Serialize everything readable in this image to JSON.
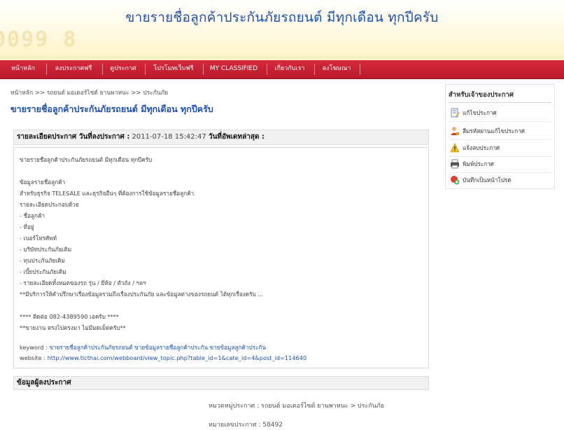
{
  "header": {
    "site_title": "ขายรายชื่อลูกค้าประกันภัยรถยนต์ มีทุกเดือน ทุกปีครับ",
    "deco_text": "0099 8"
  },
  "nav": {
    "items": [
      {
        "label": "หน้าหลัก"
      },
      {
        "label": "ลงประกาศฟรี"
      },
      {
        "label": "ดูประกาศ"
      },
      {
        "label": "โปรโมทเว็บฟรี"
      },
      {
        "label": "MY CLASSIFIED"
      },
      {
        "label": "เกี่ยวกับเรา"
      },
      {
        "label": "ลงโฆษณา"
      }
    ]
  },
  "breadcrumb": {
    "home": "หน้าหลัก",
    "sep": ">>",
    "category": "รถยนต์ มอเตอร์ไซด์ ยานพาหนะ",
    "current": "ประกันภัย"
  },
  "post": {
    "title": "ขายรายชื่อลูกค้าประกันภัยรถยนต์ มีทุกเดือน ทุกปีครับ",
    "detail_label": "รายละเอียดประกาศ วันที่ลงประกาศ :",
    "datetime": "2011-07-18 15:42:47",
    "updated_label": "วันที่อัพเดทล่าสุด :",
    "body": [
      "ขายรายชื่อลูกค้าประกันภัยรถยนต์ มีทุกเดือน ทุกปีครับ",
      "ข้อมูลรายชื่อลูกค้า",
      "สำหรับธุรกิจ TELESALE และธุรกิจอื่นๆ ที่ต้องการใช้ข้อมูลรายชื่อลูกค้า",
      "รายละเอียดประกอบด้วย",
      "- ชื่อลูกค้า",
      "- ที่อยู่",
      "- เบอร์โทรศัพท์",
      "- บริษัทประกันภัยเดิม",
      "- ทุนประกันภัยเดิม",
      "- เบี้ยประกันภัยเดิม",
      "- รายละเอียดทั้งหมดของรถ รุ่น / ยี่ห้อ / ตัวถัง / ฯลฯ",
      "**มีบริการให้คำปรึกษาเรื่องข้อมูลรวมถึงเรื่องประกันภัย และข้อมูลต่างของรถยนต์ ได้ทุกเรื่องครับ ...",
      "**** ติดต่อ 082-4389590 เอครับ ****",
      "**ขายงาน ตรงไปตรงมา ไม่มีมดเม็ดครับ**"
    ],
    "keyword_label": "keyword :",
    "keyword_value": "ขายรายชื่อลูกค้าประกันภัยรถยนต์ ขายข้อมูลรายชื่อลูกค้าประกัน ขายข้อมูลลูกค้าประกัน",
    "website_label": "website :",
    "website_value": "http://www.tlcthai.com/webboard/view_topic.php?table_id=1&cate_id=4&post_id=114640"
  },
  "poster": {
    "header": "ข้อมูลผู้ลงประกาศ",
    "category_line": "หมวดหมู่ประกาศ : รถยนต์ มอเตอร์ไซด์ ยานพาหนะ > ประกันภัย",
    "number_line": "หมายเลขประกาศ : 58492"
  },
  "sidebar": {
    "title": "สำหรับเจ้าของประกาศ",
    "items": [
      {
        "label": "แก้ไขประกาศ",
        "icon": "edit-icon"
      },
      {
        "label": "ลืมรหัสผ่านแก้ไขประกาศ",
        "icon": "user-key-icon"
      },
      {
        "label": "แจ้งลบประกาศ",
        "icon": "warning-icon"
      },
      {
        "label": "พิมพ์ประกาศ",
        "icon": "printer-icon"
      },
      {
        "label": "บันทึกเป็นหน้าโปรด",
        "icon": "favorite-icon"
      }
    ]
  },
  "colors": {
    "nav_red": "#c8202f",
    "title_blue": "#1d4fae",
    "header_cream": "#fdf1c2"
  }
}
